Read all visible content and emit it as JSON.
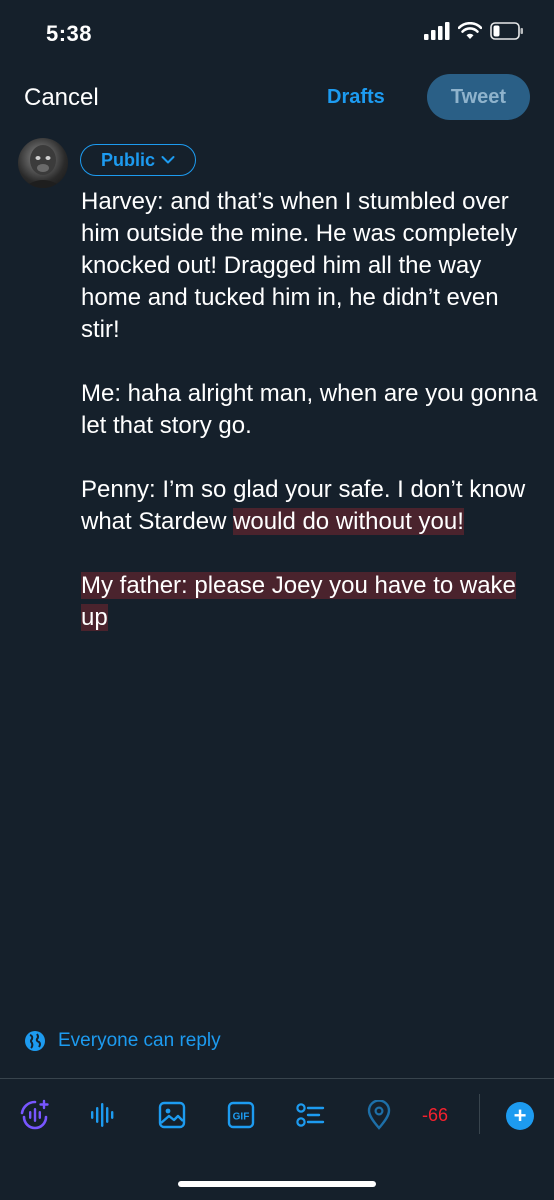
{
  "status_bar": {
    "time": "5:38"
  },
  "topbar": {
    "cancel_label": "Cancel",
    "drafts_label": "Drafts",
    "tweet_label": "Tweet"
  },
  "composer": {
    "audience_label": "Public",
    "paragraphs": {
      "p1": "Harvey: and that’s when I stumbled over him outside the mine. He was completely knocked out! Dragged him all the way home and tucked him in, he didn’t even stir!",
      "p2": "Me: haha alright man, when are you gonna let that story go.",
      "p3_normal": "Penny: I’m so glad your safe. I don’t know what Stardew ",
      "p3_over": "would do without you!",
      "p4_over": "My father: please Joey you have to wake up"
    }
  },
  "reply_setting": {
    "label": "Everyone can reply"
  },
  "toolbar": {
    "items": [
      "spaces-icon",
      "audio-icon",
      "image-icon",
      "gif-icon",
      "poll-icon",
      "location-icon"
    ],
    "gif_text": "GIF",
    "char_counter": "-66",
    "add_symbol": "+"
  },
  "colors": {
    "background": "#15202b",
    "accent": "#1d9bf0",
    "over_limit_highlight": "#4a232d",
    "counter_red": "#f4212e",
    "tweet_button_disabled": "#2a5f86",
    "spaces_purple": "#7856ff"
  }
}
